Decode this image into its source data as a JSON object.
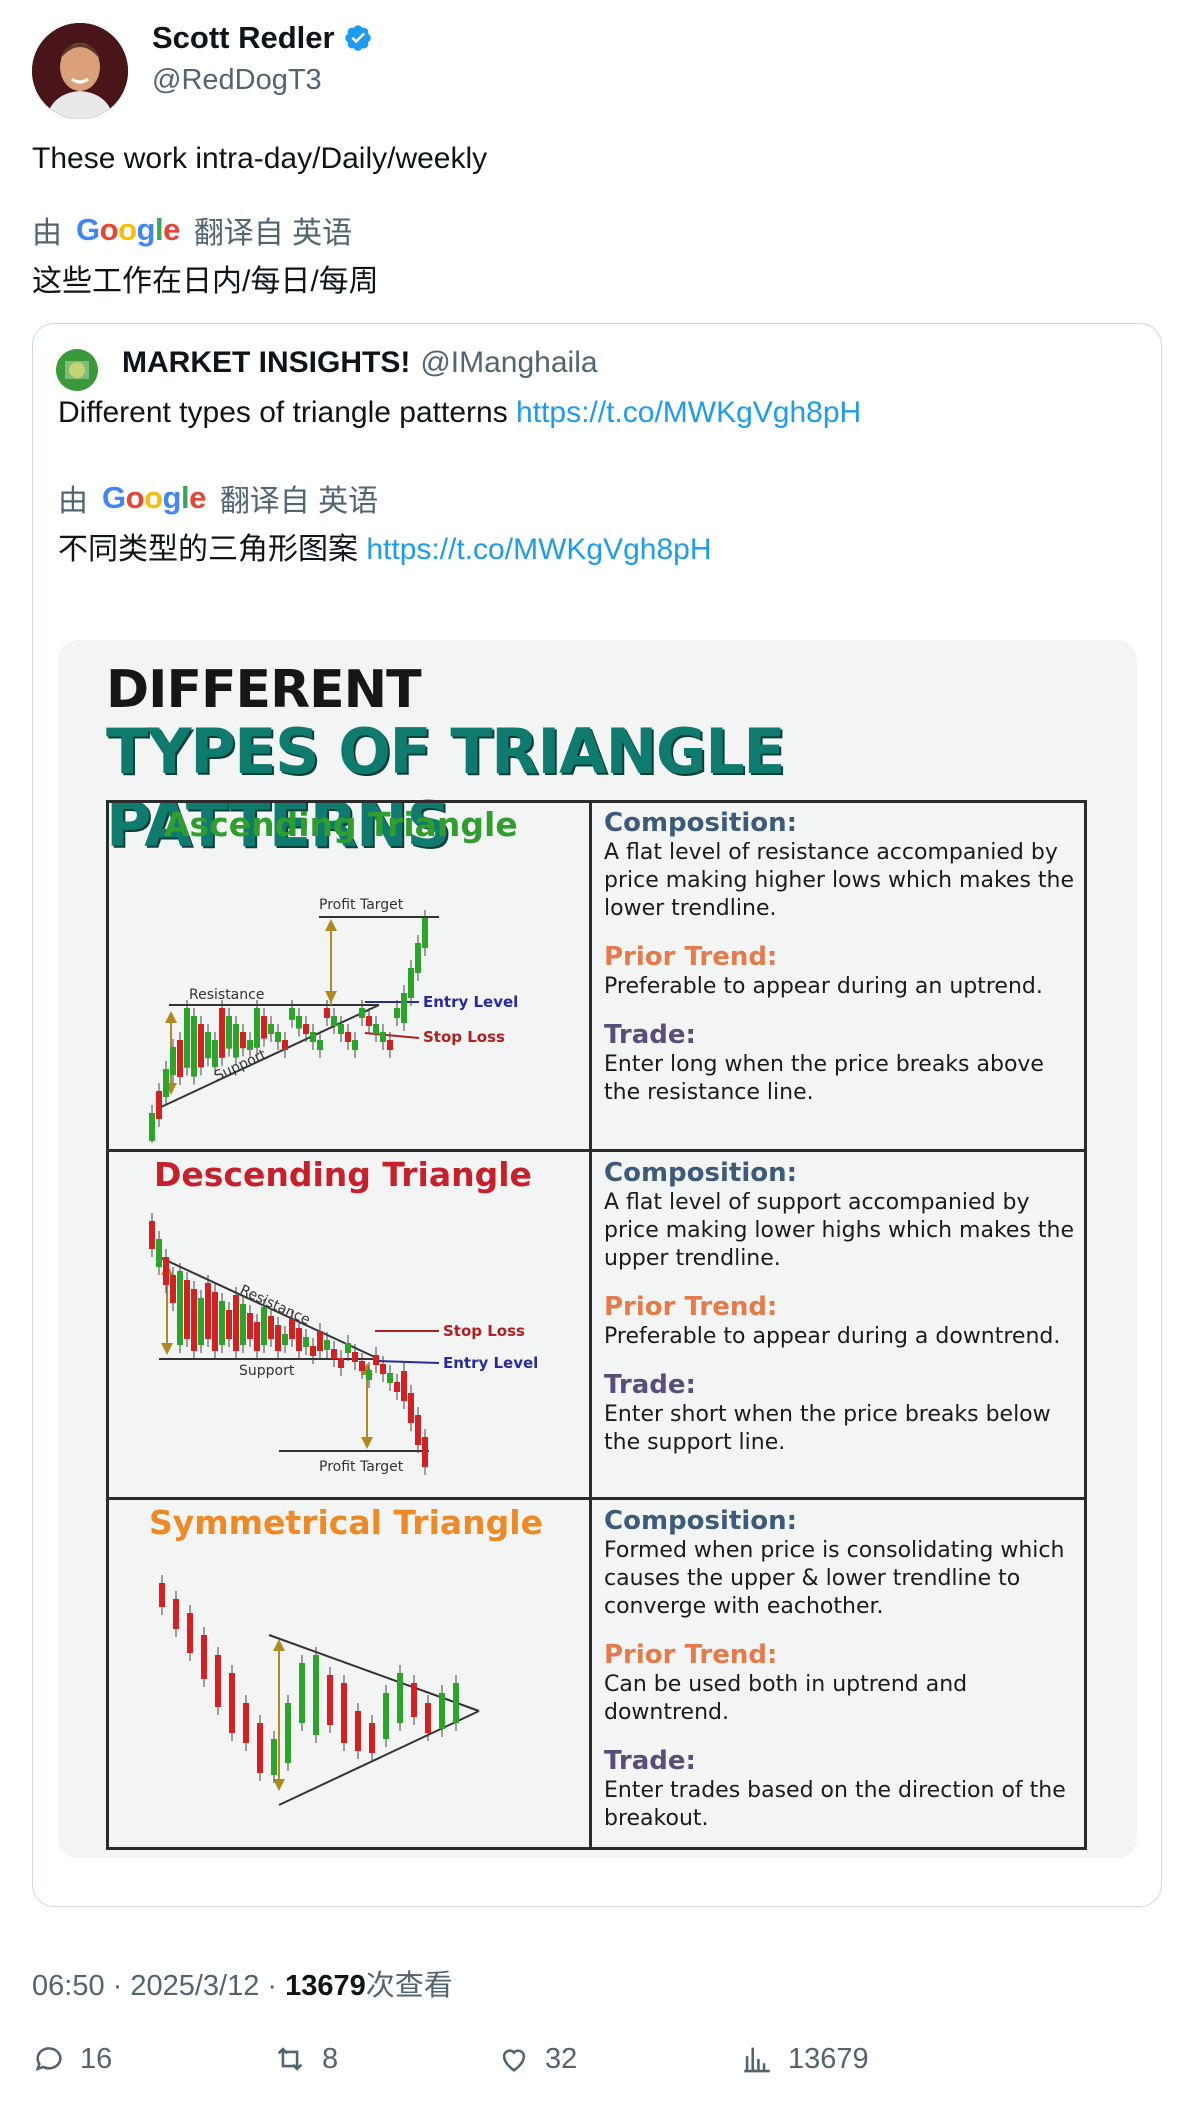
{
  "author": {
    "name": "Scott Redler",
    "handle": "@RedDogT3",
    "verified_icon": "verified-badge-icon"
  },
  "tweet": {
    "text": "These work intra-day/Daily/weekly"
  },
  "translation": {
    "prefix": "由",
    "provider": "Google",
    "suffix": "翻译自 英语",
    "text": "这些工作在日内/每日/每周"
  },
  "quoted": {
    "name": "MARKET INSIGHTS!",
    "handle": "@IManghaila",
    "text": "Different types of triangle patterns",
    "link": "https://t.co/MWKgVgh8pH",
    "translation": {
      "prefix": "由",
      "provider": "Google",
      "suffix": "翻译自 英语",
      "text": "不同类型的三角形图案",
      "link": "https://t.co/MWKgVgh8pH"
    }
  },
  "infographic": {
    "title_line1": "DIFFERENT",
    "title_line2": "TYPES OF TRIANGLE PATTERNS",
    "sections": [
      {
        "title": "Ascending Triangle",
        "title_color": "#2f9e2f",
        "labels": {
          "profit": "Profit Target",
          "resistance": "Resistance",
          "support": "Support",
          "entry": "Entry Level",
          "stop": "Stop Loss"
        },
        "composition_h": "Composition:",
        "composition": "A flat level of resistance accompanied by price making higher lows which makes the lower trendline.",
        "prior_h": "Prior Trend:",
        "prior": "Preferable to appear during an uptrend.",
        "trade_h": "Trade:",
        "trade": "Enter long when the price breaks above the resistance line."
      },
      {
        "title": "Descending Triangle",
        "title_color": "#c8202a",
        "labels": {
          "profit": "Profit Target",
          "resistance": "Resistance",
          "support": "Support",
          "entry": "Entry Level",
          "stop": "Stop Loss"
        },
        "composition_h": "Composition:",
        "composition": "A flat level of support accompanied by price making lower highs which makes the upper trendline.",
        "prior_h": "Prior Trend:",
        "prior": "Preferable to appear during a downtrend.",
        "trade_h": "Trade:",
        "trade": "Enter short when the price breaks below the support line."
      },
      {
        "title": "Symmetrical Triangle",
        "title_color": "#ee8a26",
        "composition_h": "Composition:",
        "composition": "Formed when price is consolidating which causes the upper & lower trendline to converge with eachother.",
        "prior_h": "Prior Trend:",
        "prior": "Can be used both in uptrend and downtrend.",
        "trade_h": "Trade:",
        "trade": "Enter trades based on the direction of the breakout."
      }
    ]
  },
  "meta": {
    "time": "06:50 · 2025/3/12 · ",
    "views": "13679",
    "views_suffix": "次查看"
  },
  "actions": {
    "replies": "16",
    "retweets": "8",
    "likes": "32",
    "views": "13679"
  }
}
